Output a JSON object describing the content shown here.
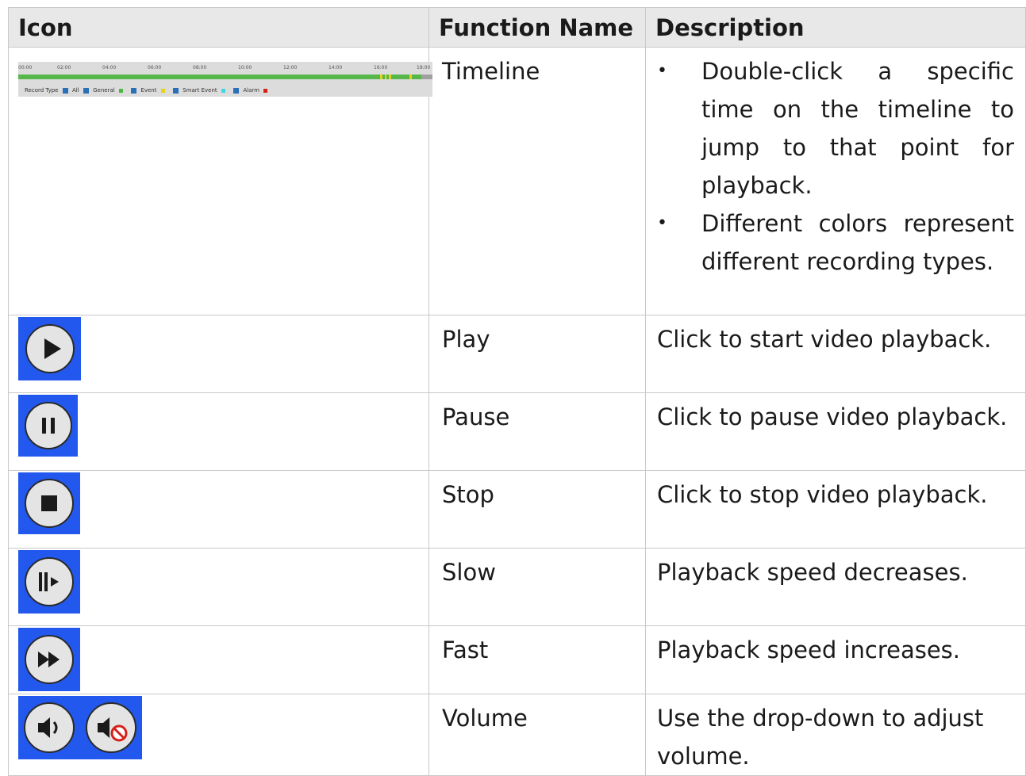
{
  "table": {
    "headers": {
      "icon": "Icon",
      "function": "Function Name",
      "description": "Description"
    },
    "timeline": {
      "name": "Timeline",
      "bullets": [
        "Double-click a specific time on the timeline to jump to that point for playback.",
        "Different colors represent different recording types."
      ],
      "ticks": [
        "00:00",
        "02:00",
        "04:00",
        "06:00",
        "08:00",
        "10:00",
        "12:00",
        "14:00",
        "16:00",
        "18:00"
      ],
      "legend": {
        "record_type": "Record Type",
        "all": "All",
        "general": "General",
        "event": "Event",
        "smart_event": "Smart Event",
        "alarm": "Alarm"
      },
      "legend_colors": {
        "general": "#49b83c",
        "event": "#e5d21a",
        "smart_event": "#3ed6e6",
        "alarm": "#d8201a"
      }
    },
    "rows": [
      {
        "icon": "play-icon",
        "name": "Play",
        "description": "Click to start video playback."
      },
      {
        "icon": "pause-icon",
        "name": "Pause",
        "description": "Click to pause video playback."
      },
      {
        "icon": "stop-icon",
        "name": "Stop",
        "description": "Click to stop video playback."
      },
      {
        "icon": "slow-icon",
        "name": "Slow",
        "description": "Playback speed decreases."
      },
      {
        "icon": "fast-icon",
        "name": "Fast",
        "description": "Playback speed increases."
      },
      {
        "icon": "volume-icon",
        "name": "Volume",
        "description": "Use the drop-down to adjust volume."
      }
    ]
  },
  "colors": {
    "icon_background": "#2258ee",
    "header_background": "#e8e8e8"
  }
}
